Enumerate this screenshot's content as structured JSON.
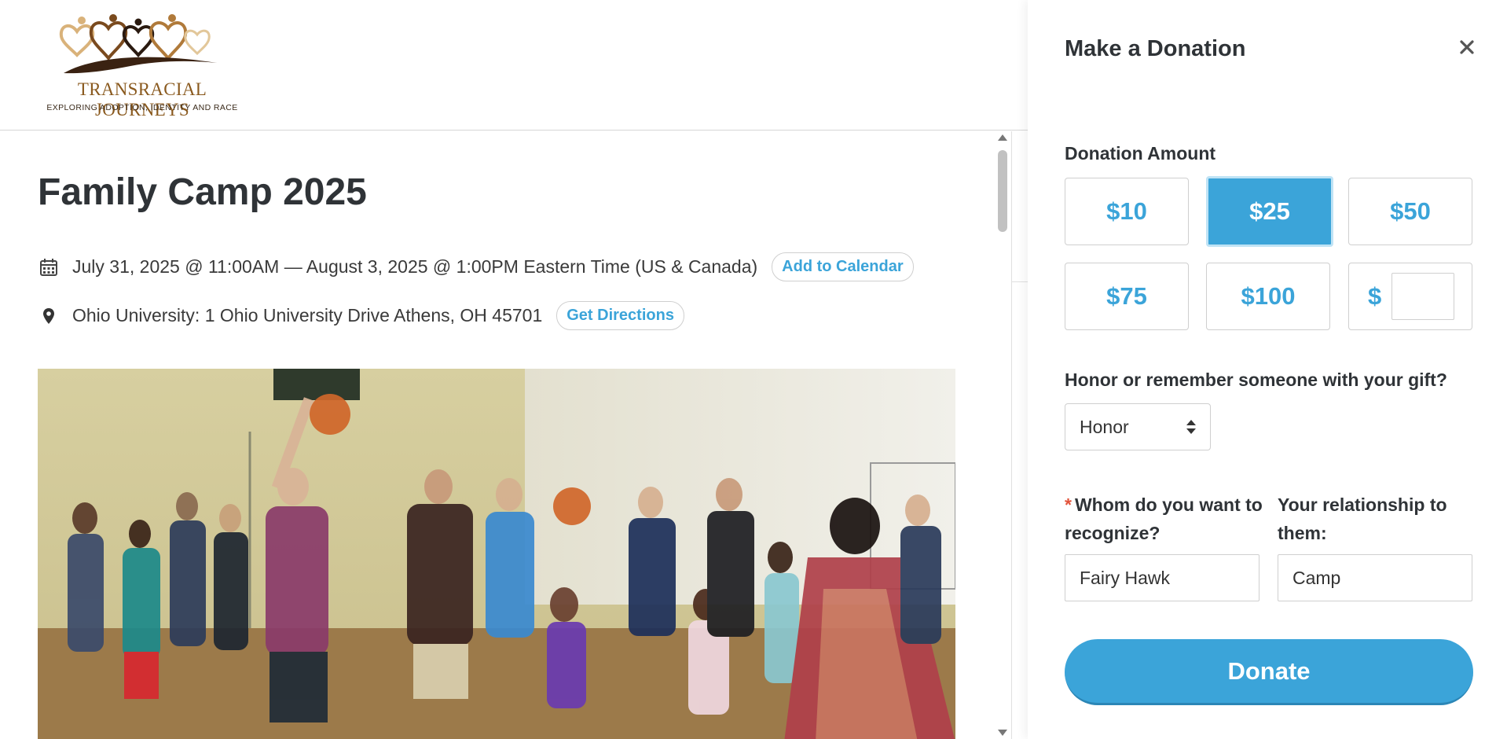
{
  "brand": {
    "name": "TRANSRACIAL JOURNEYS",
    "tagline": "EXPLORING ADOPTION, IDENTITY AND RACE"
  },
  "event": {
    "title": "Family Camp 2025",
    "datetime": "July 31, 2025 @ 11:00AM — August 3, 2025 @ 1:00PM Eastern Time (US & Canada)",
    "calendar_button": "Add to Calendar",
    "location": "Ohio University: 1 Ohio University Drive Athens, OH 45701",
    "directions_button": "Get Directions",
    "calendar_icon": "calendar-icon",
    "location_icon": "map-pin-icon"
  },
  "donation": {
    "title": "Make a Donation",
    "close_icon": "close-icon",
    "amount_label": "Donation Amount",
    "amounts": [
      "$10",
      "$25",
      "$50",
      "$75",
      "$100"
    ],
    "selected_amount": "$25",
    "custom_currency": "$",
    "custom_value": "",
    "honor_question": "Honor or remember someone with your gift?",
    "honor_selected": "Honor",
    "whom_required_marker": "*",
    "whom_label": "Whom do you want to recognize?",
    "whom_value": "Fairy Hawk",
    "relationship_label": "Your relationship to them:",
    "relationship_value": "Camp",
    "donate_button": "Donate"
  },
  "colors": {
    "accent": "#3ba4d9",
    "required": "#e2533a",
    "logo_brown": "#8a5a1f"
  }
}
